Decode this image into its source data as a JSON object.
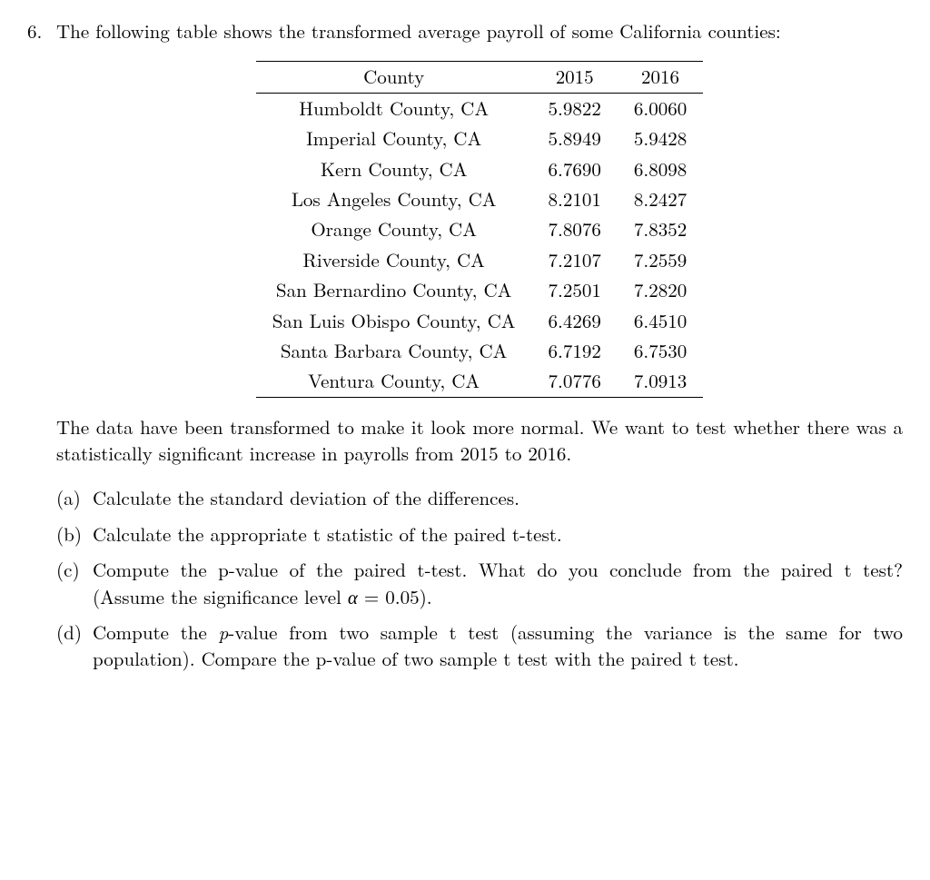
{
  "problem_number": "6.",
  "intro": "The following table shows the transformed average payroll of some California counties:",
  "table_headers": {
    "col1": "County",
    "col2": "2015",
    "col3": "2016"
  },
  "table_rows": [
    {
      "county": "Humboldt County, CA",
      "y2015": "5.9822",
      "y2016": "6.0060"
    },
    {
      "county": "Imperial County, CA",
      "y2015": "5.8949",
      "y2016": "5.9428"
    },
    {
      "county": "Kern County, CA",
      "y2015": "6.7690",
      "y2016": "6.8098"
    },
    {
      "county": "Los Angeles County, CA",
      "y2015": "8.2101",
      "y2016": "8.2427"
    },
    {
      "county": "Orange County, CA",
      "y2015": "7.8076",
      "y2016": "7.8352"
    },
    {
      "county": "Riverside County, CA",
      "y2015": "7.2107",
      "y2016": "7.2559"
    },
    {
      "county": "San Bernardino County, CA",
      "y2015": "7.2501",
      "y2016": "7.2820"
    },
    {
      "county": "San Luis Obispo County, CA",
      "y2015": "6.4269",
      "y2016": "6.4510"
    },
    {
      "county": "Santa Barbara County, CA",
      "y2015": "6.7192",
      "y2016": "6.7530"
    },
    {
      "county": "Ventura County, CA",
      "y2015": "7.0776",
      "y2016": "7.0913"
    }
  ],
  "middle": "The data have been transformed to make it look more normal. We want to test whether there was a statistically significant increase in payrolls from 2015 to 2016.",
  "parts": {
    "a": {
      "label": "(a)",
      "text": "Calculate the standard deviation of the differences."
    },
    "b": {
      "label": "(b)",
      "text": "Calculate the appropriate t statistic of the paired t-test."
    },
    "c": {
      "label": "(c)",
      "text_before": "Compute the p-value of the paired t-test. What do you conclude from the paired t test? (Assume the significance level ",
      "alpha": "α",
      "text_after": " = 0.05)."
    },
    "d": {
      "label": "(d)",
      "text_before": "Compute the ",
      "p": "p",
      "text_after": "-value from two sample t test (assuming the variance is the same for two population). Compare the p-value of two sample t test with the paired t test."
    }
  }
}
